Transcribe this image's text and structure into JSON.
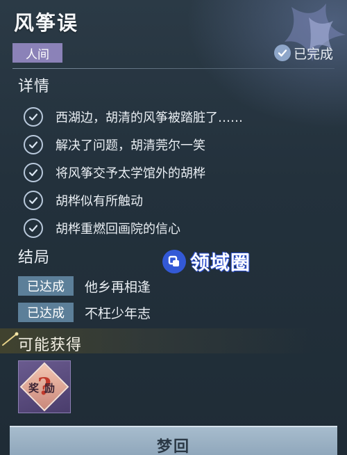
{
  "header": {
    "title": "风筝误",
    "realm_tag": "人间",
    "status_label": "已完成"
  },
  "details": {
    "heading": "详情",
    "items": [
      "西湖边，胡清的风筝被踏脏了……",
      "解决了问题，胡清莞尔一笑",
      "将风筝交予太学馆外的胡桦",
      "胡桦似有所触动",
      "胡桦重燃回画院的信心"
    ]
  },
  "ending": {
    "heading": "结局",
    "items": [
      {
        "badge": "已达成",
        "text": "他乡再相逢"
      },
      {
        "badge": "已达成",
        "text": "不枉少年志"
      }
    ]
  },
  "watermark": {
    "text": "领域圈"
  },
  "rewards": {
    "heading": "可能获得",
    "item_label": "奖励",
    "item_symbol": "?"
  },
  "actions": {
    "dream_label": "梦回"
  },
  "colors": {
    "realm_tag_bg": "#8b82b8",
    "badge_bg": "#5c7f99",
    "button_bg": "#a7bccd",
    "panel_bg": "#23313c"
  }
}
